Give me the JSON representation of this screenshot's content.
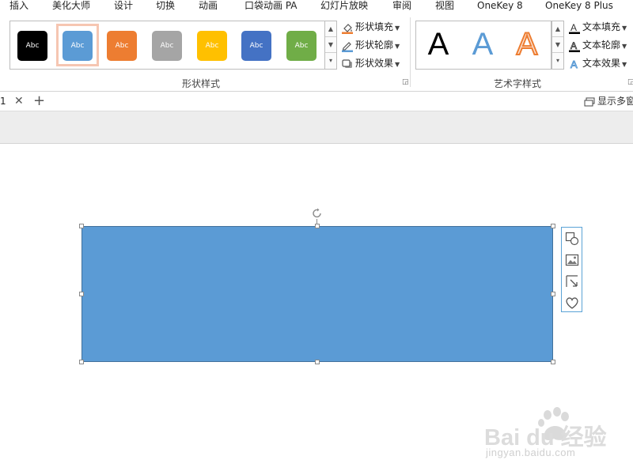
{
  "menu": {
    "items": [
      "插入",
      "美化大师",
      "设计",
      "切换",
      "动画",
      "口袋动画 PA",
      "幻灯片放映",
      "审阅",
      "视图",
      "OneKey 8",
      "OneKey 8 Plus"
    ]
  },
  "ribbon": {
    "shape_styles": {
      "swatches": [
        {
          "text": "Abc",
          "color": "#000000"
        },
        {
          "text": "Abc",
          "color": "#5b9bd5"
        },
        {
          "text": "Abc",
          "color": "#ed7d31"
        },
        {
          "text": "Abc",
          "color": "#a5a5a5"
        },
        {
          "text": "Abc",
          "color": "#ffc000"
        },
        {
          "text": "Abc",
          "color": "#4472c4"
        },
        {
          "text": "Abc",
          "color": "#70ad47"
        }
      ],
      "selected_index": 1,
      "fill_label": "形状填充",
      "outline_label": "形状轮廓",
      "effects_label": "形状效果",
      "group_label": "形状样式"
    },
    "wordart": {
      "samples": [
        {
          "text": "A",
          "style": "black"
        },
        {
          "text": "A",
          "style": "blue"
        },
        {
          "text": "A",
          "style": "orange-outline"
        }
      ],
      "fill_label": "文本填充",
      "outline_label": "文本轮廓",
      "effects_label": "文本效果",
      "group_label": "艺术字样式"
    }
  },
  "tabbar": {
    "tab_label": "1",
    "multi_window_label": "显示多窗"
  },
  "watermark": {
    "brand": "Bai du 经验",
    "url": "jingyan.baidu.com"
  },
  "colors": {
    "shape_fill": "#5b9bd5",
    "shape_border": "#41719c",
    "accent": "#5ba3d6"
  }
}
